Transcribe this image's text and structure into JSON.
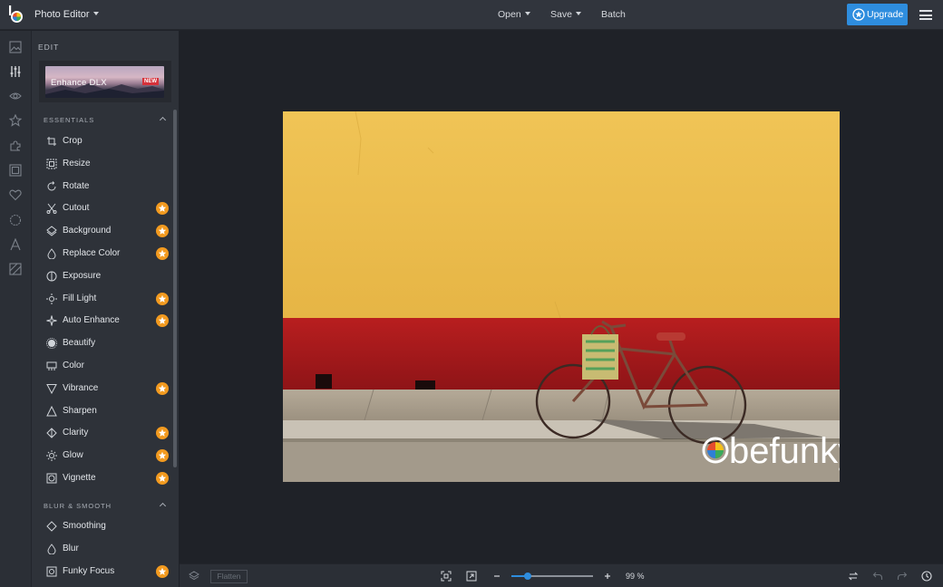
{
  "app": {
    "title": "Photo Editor",
    "menu": [
      "Open",
      "Save",
      "Batch"
    ],
    "upgrade_label": "Upgrade",
    "accent_color": "#2e8dde"
  },
  "rail_icons": [
    "image-icon",
    "sliders-icon",
    "eye-icon",
    "star-icon",
    "puzzle-icon",
    "frame-icon",
    "heart-icon",
    "badge-icon",
    "text-icon",
    "texture-icon"
  ],
  "panel": {
    "title": "EDIT",
    "banner_text": "Enhance DLX",
    "banner_badge": "NEW",
    "sections": [
      {
        "label": "ESSENTIALS",
        "tools": [
          {
            "label": "Crop",
            "icon": "crop-icon",
            "premium": false
          },
          {
            "label": "Resize",
            "icon": "resize-icon",
            "premium": false
          },
          {
            "label": "Rotate",
            "icon": "rotate-icon",
            "premium": false
          },
          {
            "label": "Cutout",
            "icon": "cutout-icon",
            "premium": true
          },
          {
            "label": "Background",
            "icon": "background-icon",
            "premium": true
          },
          {
            "label": "Replace Color",
            "icon": "replace-color-icon",
            "premium": true
          },
          {
            "label": "Exposure",
            "icon": "exposure-icon",
            "premium": false
          },
          {
            "label": "Fill Light",
            "icon": "fill-light-icon",
            "premium": true
          },
          {
            "label": "Auto Enhance",
            "icon": "auto-enhance-icon",
            "premium": true
          },
          {
            "label": "Beautify",
            "icon": "beautify-icon",
            "premium": false
          },
          {
            "label": "Color",
            "icon": "color-icon",
            "premium": false
          },
          {
            "label": "Vibrance",
            "icon": "vibrance-icon",
            "premium": true
          },
          {
            "label": "Sharpen",
            "icon": "sharpen-icon",
            "premium": false
          },
          {
            "label": "Clarity",
            "icon": "clarity-icon",
            "premium": true
          },
          {
            "label": "Glow",
            "icon": "glow-icon",
            "premium": true
          },
          {
            "label": "Vignette",
            "icon": "vignette-icon",
            "premium": true
          }
        ]
      },
      {
        "label": "BLUR & SMOOTH",
        "tools": [
          {
            "label": "Smoothing",
            "icon": "smoothing-icon",
            "premium": false
          },
          {
            "label": "Blur",
            "icon": "blur-icon",
            "premium": false
          },
          {
            "label": "Funky Focus",
            "icon": "funky-focus-icon",
            "premium": true
          }
        ]
      }
    ]
  },
  "canvas": {
    "photo_watermark": "befunky",
    "wall_color": "#edbd4a",
    "stripe_color": "#a71a1c"
  },
  "bottombar": {
    "flatten_label": "Flatten",
    "zoom_label": "99 %",
    "zoom_fraction": 0.17
  }
}
